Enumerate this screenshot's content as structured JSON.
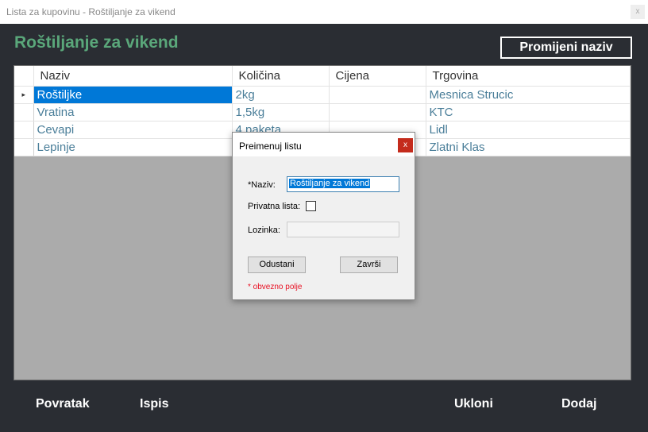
{
  "window": {
    "title": "Lista za kupovinu - Roštiljanje za vikend",
    "close_glyph": "x"
  },
  "header": {
    "list_title": "Roštiljanje za vikend",
    "rename_button": "Promijeni naziv"
  },
  "grid": {
    "columns": [
      "Naziv",
      "Količina",
      "Cijena",
      "Trgovina"
    ],
    "rows": [
      {
        "naziv": "Roštiljke",
        "kolicina": "2kg",
        "cijena": "",
        "trgovina": "Mesnica Strucic"
      },
      {
        "naziv": "Vratina",
        "kolicina": "1,5kg",
        "cijena": "",
        "trgovina": "KTC"
      },
      {
        "naziv": "Cevapi",
        "kolicina": "4 paketa",
        "cijena": "",
        "trgovina": "Lidl"
      },
      {
        "naziv": "Lepinje",
        "kolicina": "",
        "cijena": "",
        "trgovina": "Zlatni Klas"
      }
    ],
    "row_pointer_glyph": "▸"
  },
  "footer": {
    "back": "Povratak",
    "print": "Ispis",
    "remove": "Ukloni",
    "add": "Dodaj"
  },
  "dialog": {
    "title": "Preimenuj listu",
    "close_glyph": "x",
    "name_label": "*Naziv:",
    "name_value": "Roštiljanje za vikend",
    "private_label": "Privatna lista:",
    "private_checked": false,
    "password_label": "Lozinka:",
    "password_value": "",
    "cancel_button": "Odustani",
    "finish_button": "Završi",
    "required_note": "* obvezno polje"
  },
  "colors": {
    "title_green": "#5aa77a",
    "background": "#2a2d33",
    "selection_blue": "#0078d7",
    "required_red": "#e81123"
  }
}
